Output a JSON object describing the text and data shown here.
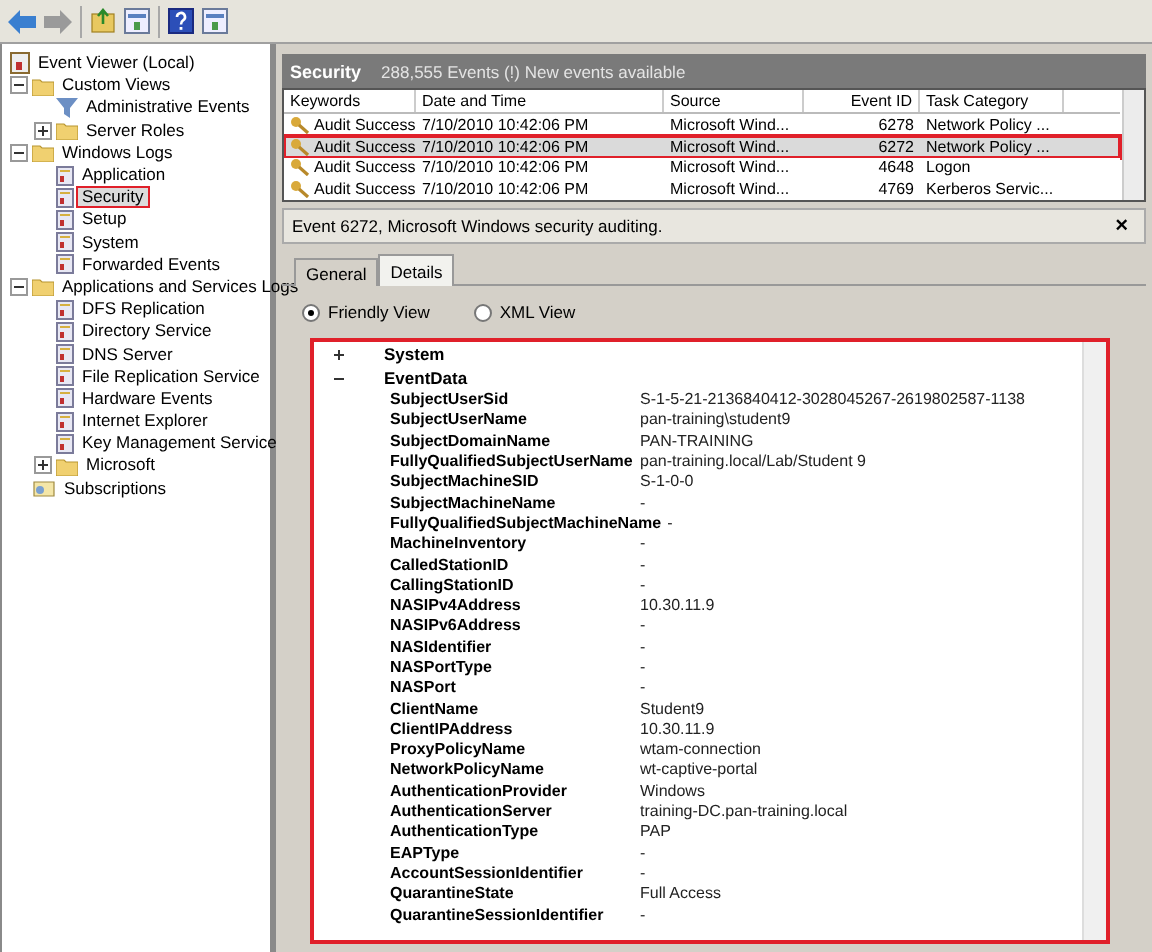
{
  "tree": [
    {
      "label": "Event Viewer (Local)",
      "kind": "viewer",
      "selected": false,
      "annotated": false,
      "children": [
        {
          "label": "Custom Views",
          "kind": "folder",
          "expanded": true,
          "selected": false,
          "annotated": false,
          "children": [
            {
              "label": "Administrative Events",
              "kind": "filter",
              "selected": false,
              "annotated": false
            },
            {
              "label": "Server Roles",
              "kind": "folder",
              "expanded": false,
              "selected": false,
              "annotated": false
            }
          ]
        },
        {
          "label": "Windows Logs",
          "kind": "folder",
          "expanded": true,
          "selected": false,
          "annotated": false,
          "children": [
            {
              "label": "Application",
              "kind": "log",
              "selected": false,
              "annotated": false
            },
            {
              "label": "Security",
              "kind": "log",
              "selected": true,
              "annotated": true
            },
            {
              "label": "Setup",
              "kind": "log",
              "selected": false,
              "annotated": false
            },
            {
              "label": "System",
              "kind": "log",
              "selected": false,
              "annotated": false
            },
            {
              "label": "Forwarded Events",
              "kind": "log",
              "selected": false,
              "annotated": false
            }
          ]
        },
        {
          "label": "Applications and Services Logs",
          "kind": "folder",
          "expanded": true,
          "selected": false,
          "annotated": false,
          "children": [
            {
              "label": "DFS Replication",
              "kind": "log",
              "selected": false,
              "annotated": false
            },
            {
              "label": "Directory Service",
              "kind": "log",
              "selected": false,
              "annotated": false
            },
            {
              "label": "DNS Server",
              "kind": "log",
              "selected": false,
              "annotated": false
            },
            {
              "label": "File Replication Service",
              "kind": "log",
              "selected": false,
              "annotated": false
            },
            {
              "label": "Hardware Events",
              "kind": "log",
              "selected": false,
              "annotated": false
            },
            {
              "label": "Internet Explorer",
              "kind": "log",
              "selected": false,
              "annotated": false
            },
            {
              "label": "Key Management Service",
              "kind": "log",
              "selected": false,
              "annotated": false
            },
            {
              "label": "Microsoft",
              "kind": "folder",
              "expanded": false,
              "selected": false,
              "annotated": false
            }
          ]
        },
        {
          "label": "Subscriptions",
          "kind": "subs",
          "selected": false,
          "annotated": false
        }
      ]
    }
  ],
  "log_header": {
    "title": "Security",
    "summary": "288,555 Events (!) New events available"
  },
  "table": {
    "columns": [
      "Keywords",
      "Date and Time",
      "Source",
      "Event ID",
      "Task Category"
    ],
    "rows": [
      {
        "cells": [
          "Audit Success",
          "7/10/2010 10:42:06 PM",
          "Microsoft Wind...",
          "6278",
          "Network Policy ..."
        ],
        "selected": false,
        "annotated": false
      },
      {
        "cells": [
          "Audit Success",
          "7/10/2010 10:42:06 PM",
          "Microsoft Wind...",
          "6272",
          "Network Policy ..."
        ],
        "selected": true,
        "annotated": true
      },
      {
        "cells": [
          "Audit Success",
          "7/10/2010 10:42:06 PM",
          "Microsoft Wind...",
          "4648",
          "Logon"
        ],
        "selected": false,
        "annotated": false
      },
      {
        "cells": [
          "Audit Success",
          "7/10/2010 10:42:06 PM",
          "Microsoft Wind...",
          "4769",
          "Kerberos Servic..."
        ],
        "selected": false,
        "annotated": false
      }
    ]
  },
  "detail": {
    "title": "Event 6272, Microsoft Windows security auditing.",
    "close": "×",
    "tabs": [
      {
        "label": "General",
        "selected": false
      },
      {
        "label": "Details",
        "selected": true
      }
    ],
    "views": [
      {
        "label": "Friendly View",
        "selected": true
      },
      {
        "label": "XML View",
        "selected": false
      }
    ],
    "annotated": true,
    "sections": [
      {
        "name": "System",
        "expanded": false
      },
      {
        "name": "EventData",
        "expanded": true,
        "fields": [
          {
            "name": "SubjectUserSid",
            "value": "S-1-5-21-2136840412-3028045267-2619802587-1138"
          },
          {
            "name": "SubjectUserName",
            "value": "pan-training\\student9"
          },
          {
            "name": "SubjectDomainName",
            "value": "PAN-TRAINING"
          },
          {
            "name": "FullyQualifiedSubjectUserName",
            "value": "pan-training.local/Lab/Student 9"
          },
          {
            "name": "SubjectMachineSID",
            "value": "S-1-0-0"
          },
          {
            "name": "SubjectMachineName",
            "value": "-"
          },
          {
            "name": "FullyQualifiedSubjectMachineName",
            "value": "-"
          },
          {
            "name": "MachineInventory",
            "value": "-"
          },
          {
            "name": "CalledStationID",
            "value": "-"
          },
          {
            "name": "CallingStationID",
            "value": "-"
          },
          {
            "name": "NASIPv4Address",
            "value": "10.30.11.9"
          },
          {
            "name": "NASIPv6Address",
            "value": "-"
          },
          {
            "name": "NASIdentifier",
            "value": "-"
          },
          {
            "name": "NASPortType",
            "value": "-"
          },
          {
            "name": "NASPort",
            "value": "-"
          },
          {
            "name": "ClientName",
            "value": "Student9"
          },
          {
            "name": "ClientIPAddress",
            "value": "10.30.11.9"
          },
          {
            "name": "ProxyPolicyName",
            "value": "wtam-connection"
          },
          {
            "name": "NetworkPolicyName",
            "value": "wt-captive-portal"
          },
          {
            "name": "AuthenticationProvider",
            "value": "Windows"
          },
          {
            "name": "AuthenticationServer",
            "value": "training-DC.pan-training.local"
          },
          {
            "name": "AuthenticationType",
            "value": "PAP"
          },
          {
            "name": "EAPType",
            "value": "-"
          },
          {
            "name": "AccountSessionIdentifier",
            "value": "-"
          },
          {
            "name": "QuarantineState",
            "value": "Full Access"
          },
          {
            "name": "QuarantineSessionIdentifier",
            "value": "-"
          }
        ]
      }
    ]
  }
}
